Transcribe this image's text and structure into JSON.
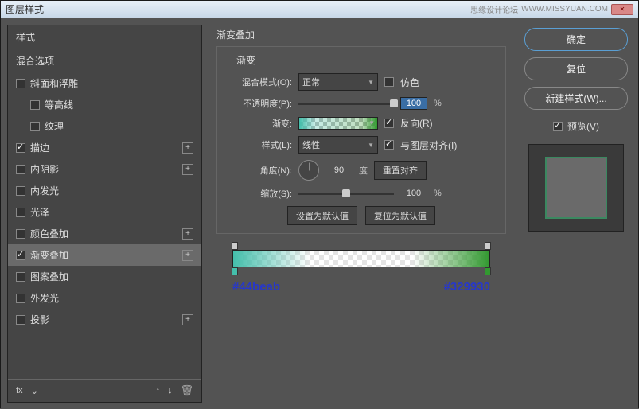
{
  "titlebar": {
    "title": "图层样式",
    "watermark": "思缘设计论坛",
    "watermark_url": "WWW.MISSYUAN.COM"
  },
  "left": {
    "section1": "样式",
    "section2": "混合选项",
    "items": [
      {
        "label": "斜面和浮雕",
        "checked": false,
        "plus": false,
        "sub": false
      },
      {
        "label": "等高线",
        "checked": false,
        "plus": false,
        "sub": true
      },
      {
        "label": "纹理",
        "checked": false,
        "plus": false,
        "sub": true
      },
      {
        "label": "描边",
        "checked": true,
        "plus": true,
        "sub": false
      },
      {
        "label": "内阴影",
        "checked": false,
        "plus": true,
        "sub": false
      },
      {
        "label": "内发光",
        "checked": false,
        "plus": false,
        "sub": false
      },
      {
        "label": "光泽",
        "checked": false,
        "plus": false,
        "sub": false
      },
      {
        "label": "颜色叠加",
        "checked": false,
        "plus": true,
        "sub": false
      },
      {
        "label": "渐变叠加",
        "checked": true,
        "plus": true,
        "sub": false,
        "selected": true
      },
      {
        "label": "图案叠加",
        "checked": false,
        "plus": false,
        "sub": false
      },
      {
        "label": "外发光",
        "checked": false,
        "plus": false,
        "sub": false
      },
      {
        "label": "投影",
        "checked": false,
        "plus": true,
        "sub": false
      }
    ],
    "footer_fx": "fx"
  },
  "center": {
    "title": "渐变叠加",
    "fieldset_label": "渐变",
    "blend_mode_label": "混合模式(O):",
    "blend_mode_value": "正常",
    "dither_label": "仿色",
    "opacity_label": "不透明度(P):",
    "opacity_value": "100",
    "opacity_unit": "%",
    "gradient_label": "渐变:",
    "reverse_label": "反向(R)",
    "style_label": "样式(L):",
    "style_value": "线性",
    "align_label": "与图层对齐(I)",
    "angle_label": "角度(N):",
    "angle_value": "90",
    "angle_unit": "度",
    "reset_align": "重置对齐",
    "scale_label": "缩放(S):",
    "scale_value": "100",
    "scale_unit": "%",
    "set_default": "设置为默认值",
    "reset_default": "复位为默认值",
    "color_left": "#44beab",
    "color_right": "#329930"
  },
  "right": {
    "ok": "确定",
    "cancel": "复位",
    "new_style": "新建样式(W)...",
    "preview_label": "预览(V)"
  }
}
